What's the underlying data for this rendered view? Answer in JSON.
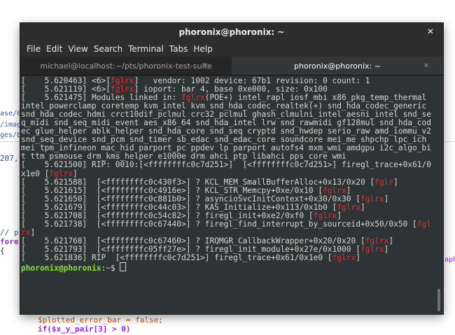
{
  "background": {
    "left_fragments": [
      "ase/0",
      "/imag",
      "ges/b",
      "207,",
      "// p",
      "fore",
      "{"
    ],
    "right_fragment": "aph",
    "code": [
      "$plotted_error_bar = false;",
      "if($x_y_pair[3] > 0)"
    ]
  },
  "window": {
    "title": "phoronix@phoronix: ~",
    "menu": [
      "File",
      "Edit",
      "View",
      "Search",
      "Terminal",
      "Tabs",
      "Help"
    ],
    "tabs": [
      {
        "label": "michael@localhost:~/pts/phoronix-test-suite",
        "active": false
      },
      {
        "label": "phoronix@phoronix: ~",
        "active": true
      }
    ]
  },
  "terminal_lines": [
    [
      [
        "[    5.620463] <6>[",
        ""
      ],
      [
        "fglrx",
        "red"
      ],
      [
        "]   vendor: 1002 device: 67b1 revision: 0 count: 1",
        ""
      ]
    ],
    [
      [
        "[    5.621119] <6>[",
        ""
      ],
      [
        "fglrx",
        "red"
      ],
      [
        "] ioport: bar 4, base 0xe000, size: 0x100",
        ""
      ]
    ],
    [
      [
        "[    5.621475] Modules linked in: ",
        ""
      ],
      [
        "fglrx",
        "red"
      ],
      [
        "(POE+) intel_rapl iosf_mbi x86_pkg_temp_thermal intel_powerclamp coretemp kvm_intel kvm snd_hda_codec_realtek(+) snd_hda_codec_generic snd_hda_codec_hdmi crct10dif_pclmul crc32_pclmul ghash_clmulni_intel aesni_intel snd_seq_midi snd_seq_midi_event aes_x86_64 snd_hda_intel lrw snd_rawmidi gf128mul snd_hda_codec glue_helper ablk_helper snd_hda_core snd_seq cryptd snd_hwdep serio_raw amd_iommu_v2 snd_seq_device snd_pcm snd_timer sb_edac snd_edac_core soundcore mei_me shpchp lpc_ich mei tpm_infineon mac_hid parport_pc ppdev lp parport autofs4 mxm_wmi amdgpu i2c_algo_bit ttm psmouse drm_kms_helper e1000e drm ahci ptp libahci pps_core wmi",
        ""
      ]
    ],
    [
      [
        "[    5.621500] RIP: 0010:[<ffffffffc0c7d251>]  [<ffffffffc0c7d251>] firegl_trace+0x61/0x1e0 [",
        ""
      ],
      [
        "fglrx",
        "red"
      ],
      [
        "]",
        ""
      ]
    ],
    [
      [
        "[    5.621588]  [<ffffffffc0c430f3>] ? KCL_MEM_SmallBufferAlloc+0x13/0x20 [",
        ""
      ],
      [
        "fglr",
        "red"
      ],
      [
        "]",
        ""
      ]
    ],
    [
      [
        "[    5.621615]  [<ffffffffc0c4916e>] ? KCL_STR_Memcpy+0xe/0x10 [",
        ""
      ],
      [
        "fglrx",
        "red"
      ],
      [
        "]",
        ""
      ]
    ],
    [
      [
        "[    5.621650]  [<ffffffffc0c881b0>] ? asyncioSvcInitContext+0x30/0x30 [",
        ""
      ],
      [
        "fglrx",
        "red"
      ],
      [
        "]",
        ""
      ]
    ],
    [
      [
        "[    5.621679]  [<ffffffffc0c44c03>] ? KAS_Initialize+0x113/0x1b0 [",
        ""
      ],
      [
        "fglrx",
        "red"
      ],
      [
        "]",
        ""
      ]
    ],
    [
      [
        "[    5.621708]  [<ffffffffc0c54c82>] ? firegl_init+0xe2/0xf0 [",
        ""
      ],
      [
        "fglrx",
        "red"
      ],
      [
        "]",
        ""
      ]
    ],
    [
      [
        "[    5.621738]  [<ffffffffc0c67440>] ? firegl_find_interrupt_by_sourceid+0x50/0x50 [",
        ""
      ],
      [
        "fglrx",
        "red"
      ],
      [
        "]",
        ""
      ]
    ],
    [
      [
        "[    5.621768]  [<ffffffffc0c67460>] ? IRQMGR_CallbackWrapper+0x20/0x20 [",
        ""
      ],
      [
        "fglrx",
        "red"
      ],
      [
        "]",
        ""
      ]
    ],
    [
      [
        "[    5.621793]  [<ffffffffc05ff27e>] ? firegl_init_module+0x27e/0x1000 [",
        ""
      ],
      [
        "fglrx",
        "red"
      ],
      [
        "]",
        ""
      ]
    ],
    [
      [
        "[    5.621836] RIP  [<ffffffffc0c7d251>] firegl_trace+0x61/0x1e0 [",
        ""
      ],
      [
        "fglrx",
        "red"
      ],
      [
        "]",
        ""
      ]
    ]
  ],
  "prompt": {
    "text": "phoronix@phoronix",
    "suffix": ":~$ "
  }
}
